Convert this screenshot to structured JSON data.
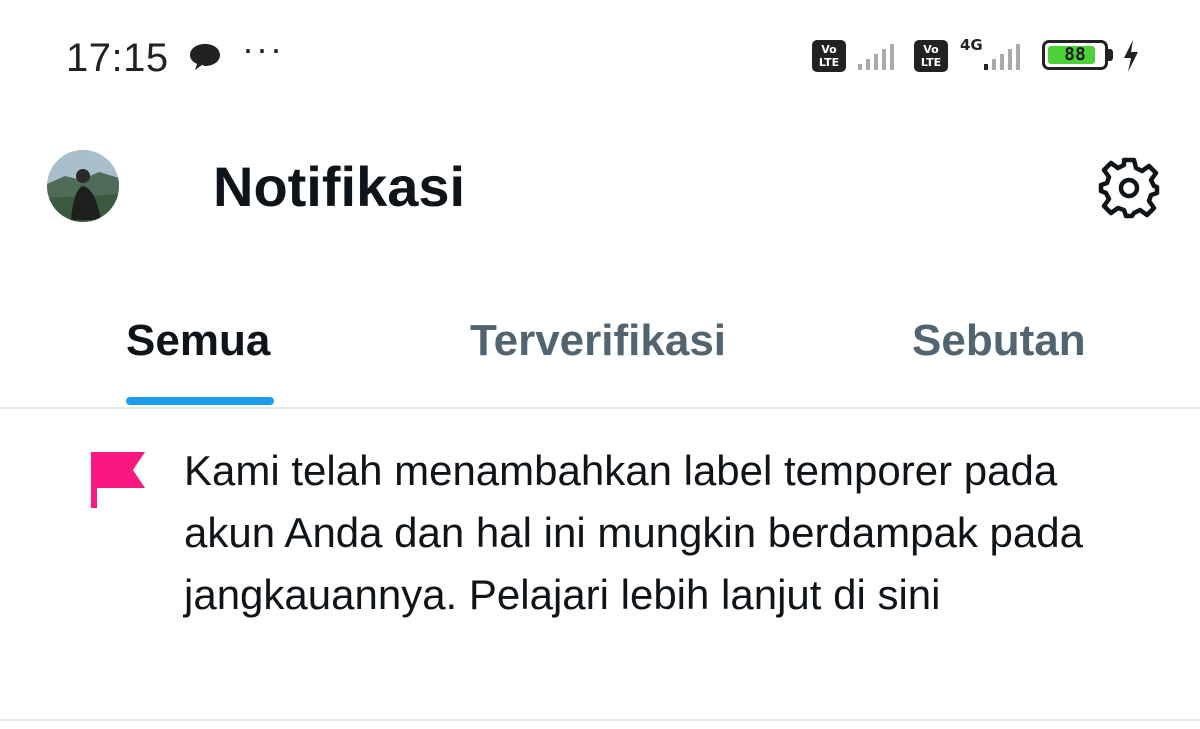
{
  "status_bar": {
    "time": "17:15",
    "volte_label": "Vo LTE",
    "network": "4G",
    "battery": "88",
    "battery_level": 0.88
  },
  "header": {
    "title": "Notifikasi"
  },
  "tabs": [
    {
      "label": "Semua",
      "active": true
    },
    {
      "label": "Terverifikasi",
      "active": false
    },
    {
      "label": "Sebutan",
      "active": false
    }
  ],
  "notifications": [
    {
      "icon": "flag-icon",
      "text": "Kami telah menambahkan label temporer pada akun Anda dan hal ini mungkin berdampak pada jangkauannya. Pelajari lebih lanjut di sini"
    }
  ],
  "colors": {
    "accent": "#1d9bf0",
    "flag": "#f91880",
    "text_primary": "#0f1419",
    "text_secondary": "#536471",
    "battery": "#4cd137"
  }
}
